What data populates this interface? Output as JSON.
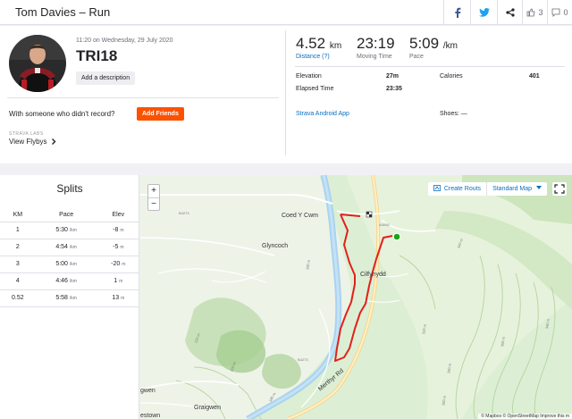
{
  "header": {
    "title": "Tom Davies – Run",
    "kudos_count": "3",
    "comment_count": "0"
  },
  "summary": {
    "datetime": "11:20 on Wednesday, 29 July 2020",
    "activity_name": "TRI18",
    "add_description": "Add a description",
    "someone_text": "With someone who didn't record?",
    "add_friends": "Add Friends",
    "labs_label": "STRAVA LABS",
    "view_flybys": "View Flybys"
  },
  "stats": {
    "distance_value": "4.52",
    "distance_unit": "km",
    "distance_label": "Distance (?)",
    "moving_time_value": "23:19",
    "moving_time_label": "Moving Time",
    "pace_value": "5:09",
    "pace_unit": "/km",
    "pace_label": "Pace"
  },
  "details": {
    "elevation_label": "Elevation",
    "elevation_value": "27m",
    "elapsed_label": "Elapsed Time",
    "elapsed_value": "23:35",
    "calories_label": "Calories",
    "calories_value": "401",
    "device": "Strava Android App",
    "shoes": "Shoes: —"
  },
  "splits": {
    "title": "Splits",
    "columns": [
      "KM",
      "Pace",
      "Elev"
    ],
    "rows": [
      {
        "km": "1",
        "pace": "5:30",
        "pace_unit": "/km",
        "elev": "-8",
        "elev_unit": "m"
      },
      {
        "km": "2",
        "pace": "4:54",
        "pace_unit": "/km",
        "elev": "-5",
        "elev_unit": "m"
      },
      {
        "km": "3",
        "pace": "5:00",
        "pace_unit": "/km",
        "elev": "-20",
        "elev_unit": "m"
      },
      {
        "km": "4",
        "pace": "4:46",
        "pace_unit": "/km",
        "elev": "1",
        "elev_unit": "m"
      },
      {
        "km": "0.52",
        "pace": "5:58",
        "pace_unit": "/km",
        "elev": "13",
        "elev_unit": "m"
      }
    ]
  },
  "map": {
    "zoom_in": "+",
    "zoom_out": "−",
    "create_route": "Create Routs",
    "map_type": "Standard Map",
    "labels": {
      "coed_y_cwm": "Coed Y Cwm",
      "glyncoch": "Glyncoch",
      "cilfynydd": "Cilfynydd",
      "merthyr_rd": "Merthyr Rd",
      "graigwen": "Graigwen",
      "gwen": "gwen",
      "estown": "estown",
      "a4058": "A4058",
      "b4273": "B4273",
      "m340": "340 m",
      "m320": "320 m",
      "m300": "300 m",
      "m260": "260 m",
      "m220": "220 m",
      "m200": "200 m",
      "m180": "180 m",
      "m160": "160 m",
      "m100": "100 m"
    },
    "attribution": "© Mapbox © OpenStreetMap Improve this m"
  },
  "colors": {
    "brand": "#fc5200",
    "link": "#0a6fc2",
    "route": "#e3201b",
    "start_marker": "#19a519"
  }
}
